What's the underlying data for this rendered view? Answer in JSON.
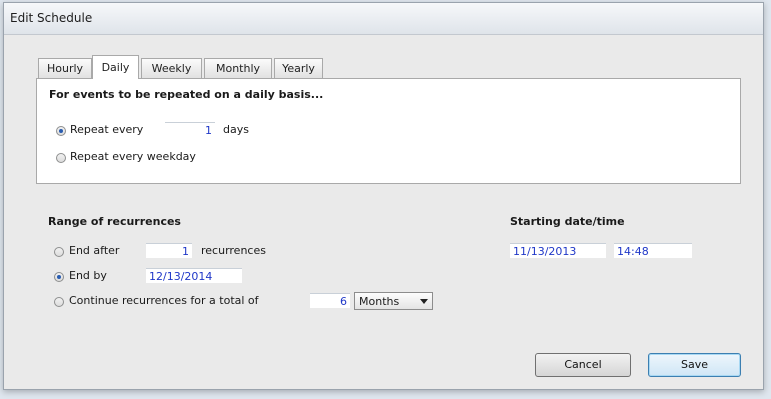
{
  "window": {
    "title": "Edit Schedule"
  },
  "tabs": [
    {
      "label": "Hourly"
    },
    {
      "label": "Daily",
      "active": true
    },
    {
      "label": "Weekly"
    },
    {
      "label": "Monthly"
    },
    {
      "label": "Yearly"
    }
  ],
  "daily": {
    "heading": "For events to be repeated on a daily basis...",
    "repeat_every_label": "Repeat every",
    "repeat_every_value": "1",
    "days_label": "days",
    "weekday_label": "Repeat every weekday",
    "selected": "repeat_every"
  },
  "range": {
    "heading": "Range of recurrences",
    "end_after_label": "End after",
    "end_after_value": "1",
    "recurrences_label": "recurrences",
    "end_by_label": "End by",
    "end_by_value": "12/13/2014",
    "continue_label": "Continue recurrences for a total of",
    "continue_value": "6",
    "period_selected": "Months",
    "selected": "end_by"
  },
  "start": {
    "heading": "Starting date/time",
    "date": "11/13/2013",
    "time": "14:48"
  },
  "buttons": {
    "cancel": "Cancel",
    "save": "Save"
  },
  "colors": {
    "field_text": "#1f37c8",
    "dialog_bg": "#eaeaea"
  }
}
